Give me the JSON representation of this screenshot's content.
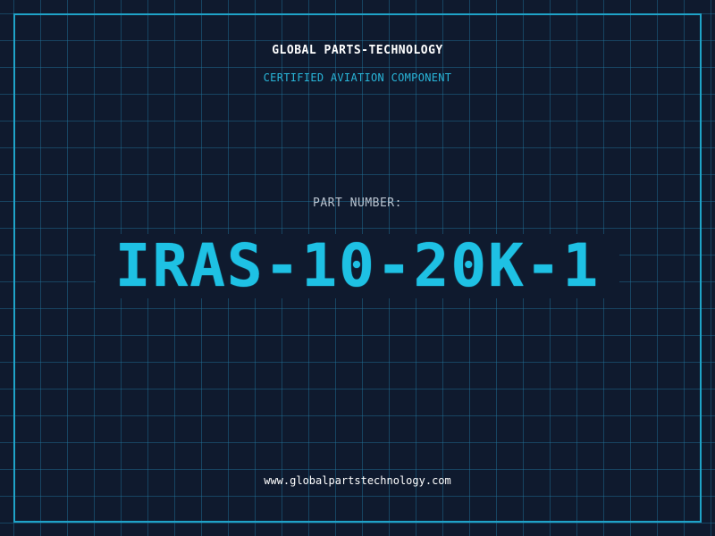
{
  "header": {
    "company": "GLOBAL PARTS-TECHNOLOGY",
    "subtitle": "CERTIFIED AVIATION COMPONENT"
  },
  "part": {
    "label": "PART NUMBER:",
    "number": "IRAS-10-20K-1"
  },
  "footer": {
    "url": "www.globalpartstechnology.com"
  },
  "colors": {
    "background": "#0f1a2e",
    "grid": "#2278a0",
    "accent": "#1ec1e4",
    "frame": "#1fa3c8"
  }
}
